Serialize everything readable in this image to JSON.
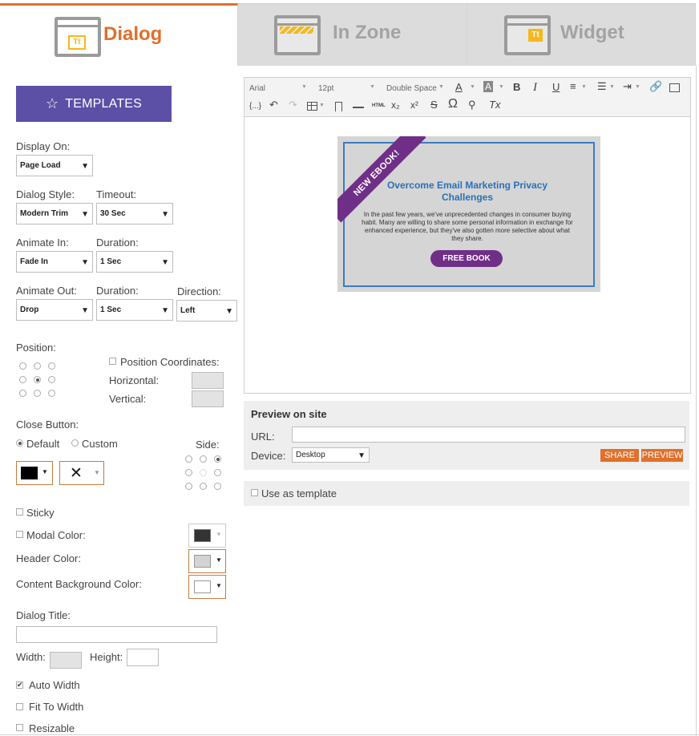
{
  "tabs": [
    {
      "label": "Dialog",
      "icon": "dialog-window-icon",
      "active": true
    },
    {
      "label": "In Zone",
      "icon": "inzone-window-icon",
      "active": false
    },
    {
      "label": "Widget",
      "icon": "widget-window-icon",
      "active": false
    }
  ],
  "tab_icon_text": "Tt",
  "templates_button": {
    "label": "TEMPLATES",
    "icon": "star-outline-icon"
  },
  "settings": {
    "display_on": {
      "label": "Display On:",
      "value": "Page Load"
    },
    "dialog_style": {
      "label": "Dialog Style:",
      "value": "Modern Trim"
    },
    "timeout": {
      "label": "Timeout:",
      "value": "30 Sec"
    },
    "animate_in": {
      "label": "Animate In:",
      "value": "Fade In"
    },
    "animate_in_duration": {
      "label": "Duration:",
      "value": "1 Sec"
    },
    "animate_out": {
      "label": "Animate Out:",
      "value": "Drop"
    },
    "animate_out_duration": {
      "label": "Duration:",
      "value": "1 Sec"
    },
    "direction": {
      "label": "Direction:",
      "value": "Left"
    },
    "position": {
      "label": "Position:",
      "selected": "center"
    },
    "position_coordinates": {
      "label": "Position Coordinates:",
      "horizontal_label": "Horizontal:",
      "vertical_label": "Vertical:"
    },
    "close_button": {
      "label": "Close Button:",
      "default_label": "Default",
      "custom_label": "Custom",
      "side_label": "Side:",
      "selected": "default",
      "side_selected": "top-right"
    },
    "close_color": "#000000",
    "close_symbol": "✕",
    "sticky": {
      "label": "Sticky",
      "checked": false
    },
    "modal_color": {
      "label": "Modal Color:",
      "checked": false,
      "color": "#333333"
    },
    "header_color": {
      "label": "Header Color:",
      "color": "#d3d3d3"
    },
    "content_bg_color": {
      "label": "Content Background Color:",
      "color": "#ffffff"
    },
    "dialog_title": {
      "label": "Dialog Title:",
      "value": ""
    },
    "width": {
      "label": "Width:",
      "value": ""
    },
    "height": {
      "label": "Height:",
      "value": ""
    },
    "auto_width": {
      "label": "Auto Width",
      "checked": true
    },
    "fit_to_width": {
      "label": "Fit To Width",
      "checked": false
    },
    "resizable": {
      "label": "Resizable",
      "checked": false
    }
  },
  "editor": {
    "font": "Arial",
    "size": "12pt",
    "line_spacing": "Double Space",
    "text_color_label": "A",
    "bg_color_label": "A",
    "bold_label": "B",
    "italic_label": "I",
    "underline_label": "U",
    "html_label": "HTML",
    "source_label": "{...}",
    "subscript_label": "x₂",
    "superscript_label": "x²",
    "strike_label": "S",
    "omega_label": "Ω",
    "clear_label": "Tx"
  },
  "preview_content": {
    "ribbon": "NEW EBOOK!",
    "title": "Overcome Email Marketing Privacy Challenges",
    "body": "In the past few years, we've unprecedented changes in consumer buying habit. Many are willing to share some personal information in exchange for enhanced experience, but they've also gotten more selective about what they share.",
    "button": "FREE BOOK"
  },
  "preview_on_site": {
    "heading": "Preview on site",
    "url_label": "URL:",
    "url_value": "",
    "device_label": "Device:",
    "device_value": "Desktop",
    "share_label": "SHARE",
    "preview_label": "PREVIEW"
  },
  "use_as_template": {
    "label": "Use as template",
    "checked": false
  },
  "colors": {
    "accent": "#e0702a",
    "templates_button": "#5c4fa6",
    "ebook_purple": "#6f2f87",
    "title_blue": "#2a70b8"
  }
}
